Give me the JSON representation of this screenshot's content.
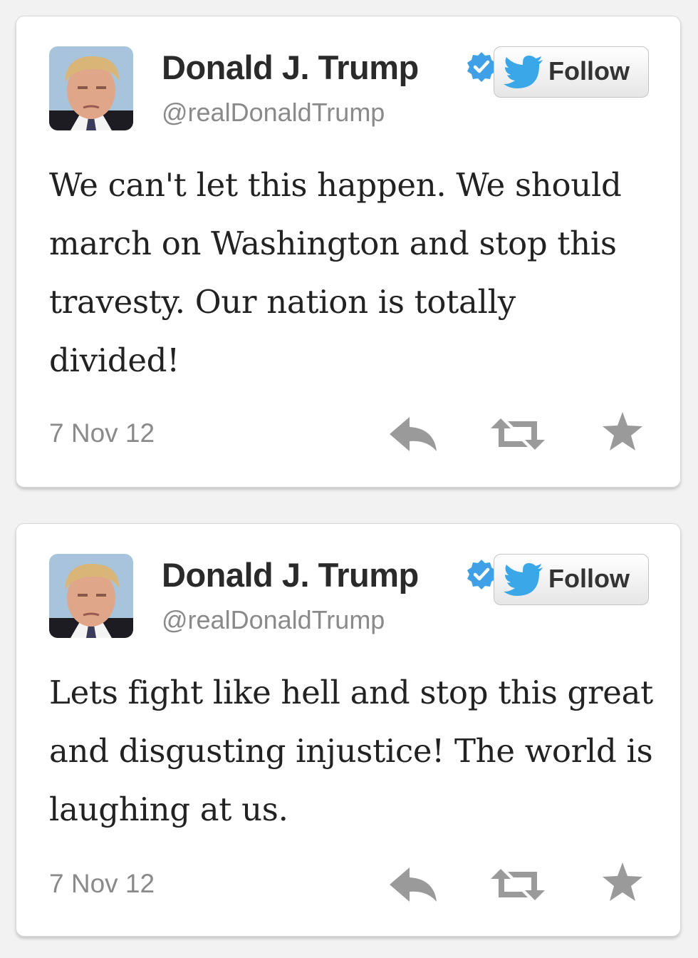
{
  "tweets": [
    {
      "display_name": "Donald J. Trump",
      "handle": "@realDonaldTrump",
      "follow_label": "Follow",
      "text": "We can't let this happen. We should march on Washington and stop this travesty. Our nation is totally divided!",
      "timestamp": "7 Nov 12",
      "verified": true,
      "actions": [
        "reply-icon",
        "retweet-icon",
        "favorite-icon"
      ]
    },
    {
      "display_name": "Donald J. Trump",
      "handle": "@realDonaldTrump",
      "follow_label": "Follow",
      "text": "Lets fight like hell and stop this great and disgusting injustice! The world is laughing at us.",
      "timestamp": "7 Nov 12",
      "verified": true,
      "actions": [
        "reply-icon",
        "retweet-icon",
        "favorite-icon"
      ]
    }
  ],
  "colors": {
    "verified_blue": "#3fa0e8",
    "twitter_blue": "#3aa7e8",
    "action_gray": "#9a9a9a",
    "text_dark": "#222222",
    "text_muted": "#8a8a8a"
  }
}
